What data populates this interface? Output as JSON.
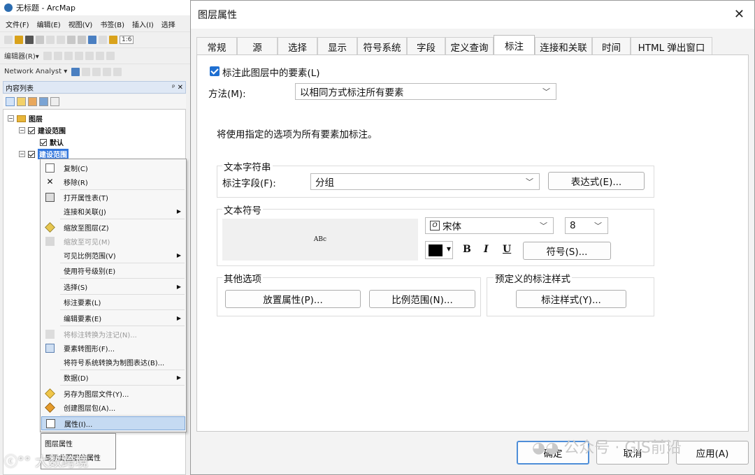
{
  "arcmap": {
    "title": "无标题 - ArcMap",
    "menu": [
      "文件(F)",
      "编辑(E)",
      "视图(V)",
      "书签(B)",
      "插入(I)",
      "选择"
    ],
    "scale_box": "1:6",
    "editor_label": "编辑器(R)▾",
    "network_analyst": "Network Analyst ▾",
    "toc_title": "内容列表",
    "toc_pin": "ᵖ ✕",
    "layers_root": "图层",
    "layer1": "建设范围",
    "layer1_child": "默认",
    "layer2": "建设范围",
    "context_menu": [
      {
        "label": "复制(C)",
        "icon": "copy-icon"
      },
      {
        "label": "移除(R)",
        "icon": "remove-icon"
      },
      {
        "label": "打开属性表(T)",
        "icon": "table-icon"
      },
      {
        "label": "连接和关联(J)",
        "icon": "",
        "submenu": true
      },
      {
        "label": "缩放至图层(Z)",
        "icon": "zoom-layer-icon"
      },
      {
        "label": "缩放至可见(M)",
        "icon": "zoom-visible-icon",
        "disabled": true
      },
      {
        "label": "可见比例范围(V)",
        "icon": "",
        "submenu": true
      },
      {
        "label": "使用符号级别(E)",
        "icon": ""
      },
      {
        "label": "选择(S)",
        "icon": "",
        "submenu": true
      },
      {
        "label": "标注要素(L)",
        "icon": ""
      },
      {
        "label": "编辑要素(E)",
        "icon": "",
        "submenu": true
      },
      {
        "label": "将标注转换为注记(N)...",
        "icon": "convert-annotation-icon",
        "disabled": true
      },
      {
        "label": "要素转图形(F)...",
        "icon": "feature-graphic-icon"
      },
      {
        "label": "将符号系统转换为制图表达(B)...",
        "icon": ""
      },
      {
        "label": "数据(D)",
        "icon": "",
        "submenu": true
      },
      {
        "label": "另存为图层文件(Y)...",
        "icon": "save-layer-icon"
      },
      {
        "label": "创建图层包(A)...",
        "icon": "layer-package-icon"
      },
      {
        "label": "属性(I)...",
        "icon": "properties-icon",
        "highlighted": true
      }
    ],
    "tooltip_title": "图层属性",
    "tooltip_text": "显示此图层的属性"
  },
  "dialog": {
    "title": "图层属性",
    "close": "✕",
    "tabs": [
      "常规",
      "源",
      "选择",
      "显示",
      "符号系统",
      "字段",
      "定义查询",
      "标注",
      "连接和关联",
      "时间",
      "HTML 弹出窗口"
    ],
    "selected_tab": "标注",
    "label_features_checkbox": "标注此图层中的要素(L)",
    "method_label": "方法(M):",
    "method_value": "以相同方式标注所有要素",
    "info_text": "将使用指定的选项为所有要素加标注。",
    "text_string_group": "文本字符串",
    "label_field_label": "标注字段(F):",
    "label_field_value": "分组",
    "expression_button": "表达式(E)...",
    "text_symbol_group": "文本符号",
    "preview_text": "ABc",
    "font_name": "宋体",
    "font_size": "8",
    "bold": "B",
    "italic": "I",
    "underline": "U",
    "symbol_button": "符号(S)...",
    "text_color": "#000000",
    "other_options_group": "其他选项",
    "placement_button": "放置属性(P)...",
    "scale_range_button": "比例范围(N)...",
    "predefined_group": "预定义的标注样式",
    "label_styles_button": "标注样式(Y)...",
    "ok_button": "确定",
    "cancel_button": "取消",
    "apply_button": "应用(A)"
  },
  "watermark": {
    "public": "公众号 · GIS前沿",
    "brand": "大数跨境"
  }
}
